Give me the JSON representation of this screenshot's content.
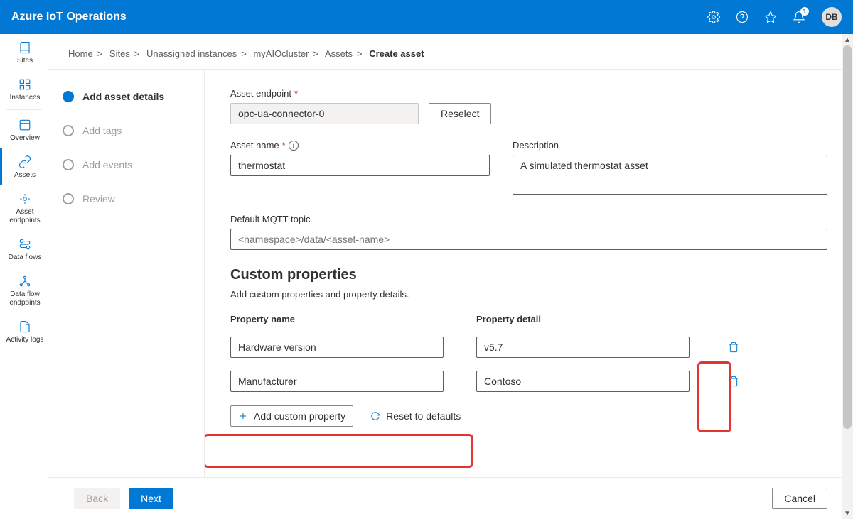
{
  "header": {
    "title": "Azure IoT Operations",
    "notification_count": "1",
    "avatar": "DB"
  },
  "nav": {
    "items": [
      {
        "label": "Sites"
      },
      {
        "label": "Instances"
      },
      {
        "label": "Overview"
      },
      {
        "label": "Assets"
      },
      {
        "label": "Asset endpoints"
      },
      {
        "label": "Data flows"
      },
      {
        "label": "Data flow endpoints"
      },
      {
        "label": "Activity logs"
      }
    ]
  },
  "breadcrumb": {
    "items": [
      "Home",
      "Sites",
      "Unassigned instances",
      "myAIOcluster",
      "Assets"
    ],
    "current": "Create asset"
  },
  "steps": [
    {
      "label": "Add asset details",
      "state": "active"
    },
    {
      "label": "Add tags",
      "state": "inactive"
    },
    {
      "label": "Add events",
      "state": "inactive"
    },
    {
      "label": "Review",
      "state": "inactive"
    }
  ],
  "form": {
    "endpoint_label": "Asset endpoint",
    "endpoint_value": "opc-ua-connector-0",
    "reselect": "Reselect",
    "name_label": "Asset name",
    "name_value": "thermostat",
    "desc_label": "Description",
    "desc_value": "A simulated thermostat asset",
    "mqtt_label": "Default MQTT topic",
    "mqtt_placeholder": "<namespace>/data/<asset-name>",
    "custom_title": "Custom properties",
    "custom_desc": "Add custom properties and property details.",
    "col_name": "Property name",
    "col_detail": "Property detail",
    "props": [
      {
        "name": "Hardware version",
        "detail": "v5.7"
      },
      {
        "name": "Manufacturer",
        "detail": "Contoso"
      }
    ],
    "add_prop": "Add custom property",
    "reset": "Reset to defaults"
  },
  "footer": {
    "back": "Back",
    "next": "Next",
    "cancel": "Cancel"
  }
}
